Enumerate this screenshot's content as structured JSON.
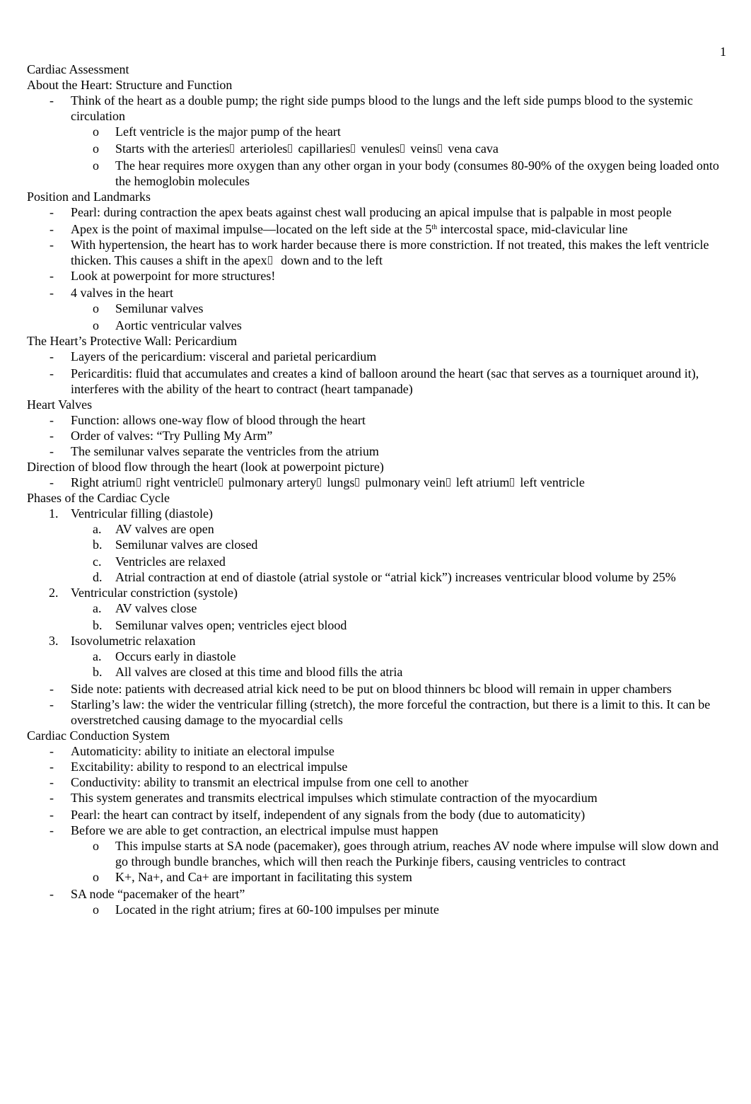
{
  "page_number": "1",
  "title": "Cardiac Assessment",
  "sections": {
    "structure": {
      "heading": "About the Heart: Structure and Function",
      "b1": "Think of the heart as a double pump; the right side pumps blood to the lungs and the left side pumps blood to the systemic circulation",
      "b1a": "Left ventricle is the major pump of the heart",
      "b1b": {
        "prefix": "Starts with the arteries",
        "steps": [
          "arterioles",
          "capillaries",
          "venules",
          "veins",
          "vena cava"
        ]
      },
      "b1c": "The hear requires more oxygen than any other organ in your body (consumes 80-90% of the oxygen being loaded onto the hemoglobin molecules"
    },
    "position": {
      "heading": "Position and Landmarks",
      "b1": "Pearl: during contraction the apex beats against chest wall producing an apical impulse that is palpable in most people",
      "b2_pre": "Apex is the point of maximal impulse—located on the left side at the 5",
      "b2_sup": "th",
      "b2_post": " intercostal space, mid-clavicular line",
      "b3_pre": "With hypertension, the heart has to work harder because there is more constriction.  If not treated, this makes the left ventricle thicken.  This causes a shift in the apex",
      "b3_post": "down and to the left",
      "b4": "Look at powerpoint for more structures!",
      "b5": "4 valves in the heart",
      "b5a": "Semilunar valves",
      "b5b": "Aortic ventricular valves"
    },
    "pericardium": {
      "heading": "The Heart’s Protective Wall: Pericardium",
      "b1": "Layers of the pericardium: visceral and parietal pericardium",
      "b2": "Pericarditis: fluid that accumulates and creates a kind of balloon around the heart (sac that serves as a tourniquet around it), interferes with the ability of the heart to contract (heart tampanade)"
    },
    "valves": {
      "heading": "Heart Valves",
      "b1": "Function: allows one-way flow of blood through the heart",
      "b2": "Order of valves: “Try Pulling My Arm”",
      "b3": "The semilunar valves separate the ventricles from the atrium"
    },
    "flow": {
      "heading": "Direction of blood flow through the heart (look at powerpoint picture)",
      "steps": [
        "Right atrium",
        "right ventricle",
        "pulmonary artery",
        "lungs",
        "pulmonary vein",
        "left atrium",
        "left ventricle"
      ]
    },
    "cycle": {
      "heading": "Phases of the Cardiac Cycle",
      "p1": "Ventricular filling (diastole)",
      "p1a": "AV valves are open",
      "p1b": "Semilunar valves are closed",
      "p1c": "Ventricles are relaxed",
      "p1d": "Atrial contraction at end of diastole (atrial systole or “atrial kick”) increases ventricular blood volume by 25%",
      "p2": "Ventricular constriction (systole)",
      "p2a": "AV valves close",
      "p2b": "Semilunar valves open; ventricles eject blood",
      "p3": "Isovolumetric relaxation",
      "p3a": "Occurs early in diastole",
      "p3b": "All valves are closed at this time and blood fills the atria",
      "note1": "Side note: patients with decreased atrial kick need to be put on blood thinners bc blood will remain in upper chambers",
      "note2": "Starling’s law: the wider the ventricular filling (stretch), the more forceful the contraction, but there is a limit to this.  It can be overstretched causing damage to the myocardial cells"
    },
    "conduction": {
      "heading": "Cardiac Conduction System",
      "b1": "Automaticity: ability to initiate an electoral impulse",
      "b2": "Excitability: ability to respond to an electrical impulse",
      "b3": "Conductivity: ability to transmit an electrical impulse from one cell to another",
      "b4": "This system generates and transmits electrical impulses which stimulate contraction of the myocardium",
      "b5": "Pearl: the heart can contract by itself, independent of any signals from the body (due to automaticity)",
      "b6": "Before we are able to get contraction, an electrical impulse must happen",
      "b6a": "This impulse starts at SA node (pacemaker), goes through atrium, reaches AV node where impulse will slow down and go through bundle branches, which will then reach the Purkinje fibers, causing ventricles to contract",
      "b6b": "K+, Na+, and Ca+ are important in facilitating this system",
      "b7": "SA node “pacemaker of the heart”",
      "b7a": "Located in the right atrium; fires at 60-100 impulses per minute"
    }
  },
  "markers": {
    "dash": "-",
    "circle": "o",
    "n1": "1.",
    "n2": "2.",
    "n3": "3.",
    "a": "a.",
    "b": "b.",
    "c": "c.",
    "d": "d."
  }
}
